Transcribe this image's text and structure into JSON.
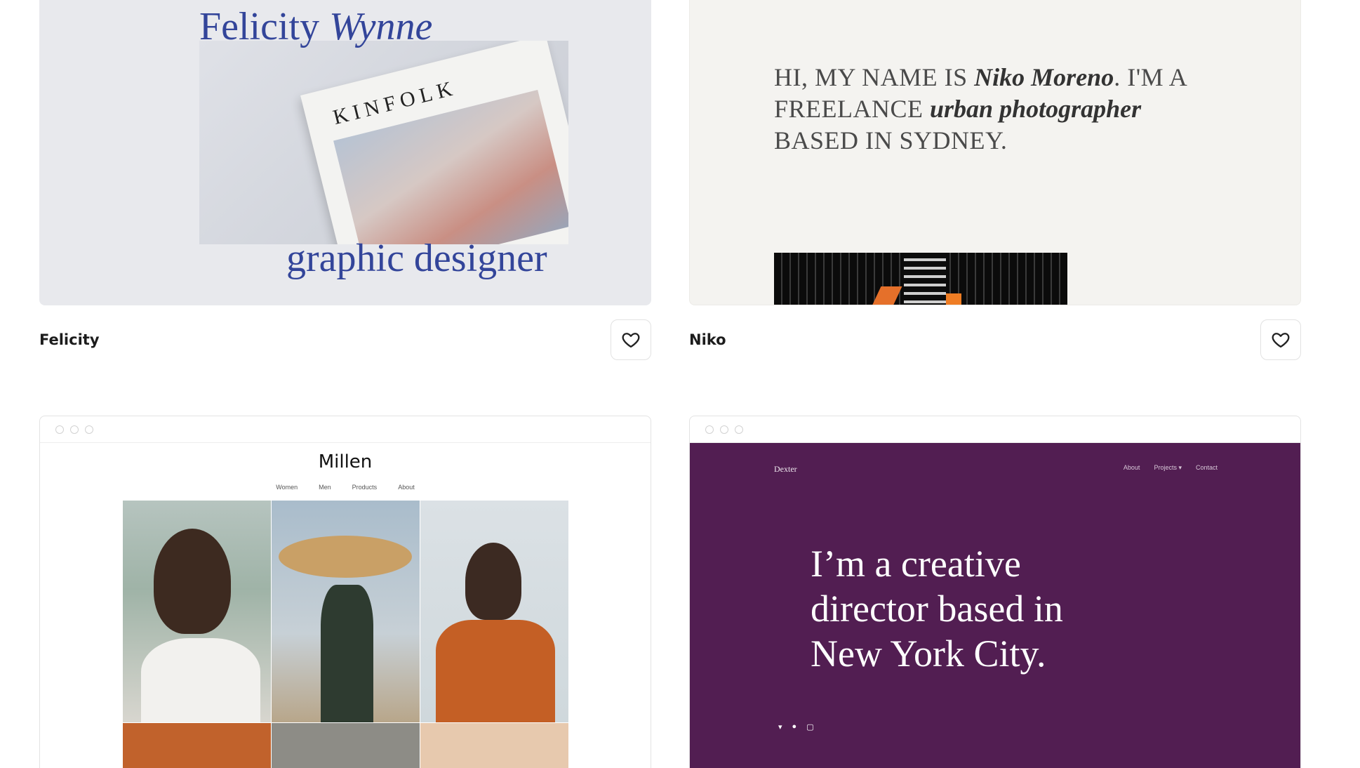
{
  "cards": [
    {
      "name": "Felicity",
      "template": {
        "title_regular": "Felicity ",
        "title_italic": "Wynne",
        "magazine_title": "KINFOLK",
        "subtitle": "graphic designer"
      },
      "favorite_icon": "heart-icon"
    },
    {
      "name": "Niko",
      "template": {
        "line1_pre": "HI, MY NAME IS ",
        "line1_name": "Niko Moreno",
        "line1_post": ". I'M A",
        "line2_pre": "FREELANCE ",
        "line2_role": "urban photographer",
        "line3": "BASED IN SYDNEY."
      },
      "favorite_icon": "heart-icon"
    },
    {
      "name": "Millen",
      "template": {
        "title": "Millen",
        "nav": [
          "Women",
          "Men",
          "Products",
          "About"
        ]
      }
    },
    {
      "name": "Dexter",
      "template": {
        "logo": "Dexter",
        "nav": [
          "About",
          "Projects ▾",
          "Contact"
        ],
        "hero_line1": "I’m a creative",
        "hero_line2": "director based in",
        "hero_line3": "New York City.",
        "social": [
          "twitter-icon",
          "facebook-icon",
          "instagram-icon"
        ]
      }
    }
  ],
  "colors": {
    "felicity_accent": "#33459a",
    "dexter_background": "#521e52",
    "niko_background": "#f4f3f0"
  }
}
